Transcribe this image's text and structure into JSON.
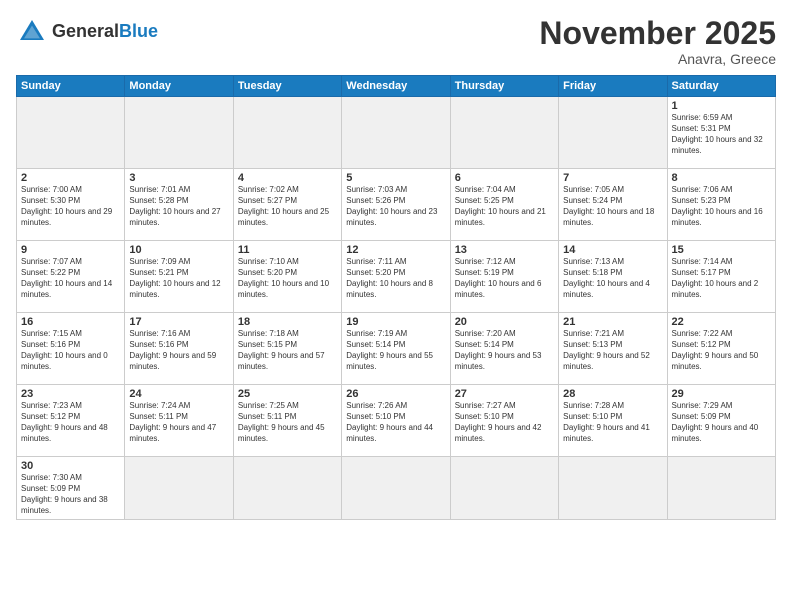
{
  "header": {
    "logo_general": "General",
    "logo_blue": "Blue",
    "month_title": "November 2025",
    "location": "Anavra, Greece"
  },
  "weekdays": [
    "Sunday",
    "Monday",
    "Tuesday",
    "Wednesday",
    "Thursday",
    "Friday",
    "Saturday"
  ],
  "weeks": [
    [
      {
        "day": "",
        "empty": true
      },
      {
        "day": "",
        "empty": true
      },
      {
        "day": "",
        "empty": true
      },
      {
        "day": "",
        "empty": true
      },
      {
        "day": "",
        "empty": true
      },
      {
        "day": "",
        "empty": true
      },
      {
        "day": "1",
        "sunrise": "6:59 AM",
        "sunset": "5:31 PM",
        "daylight": "10 hours and 32 minutes."
      }
    ],
    [
      {
        "day": "2",
        "sunrise": "7:00 AM",
        "sunset": "5:30 PM",
        "daylight": "10 hours and 29 minutes."
      },
      {
        "day": "3",
        "sunrise": "7:01 AM",
        "sunset": "5:28 PM",
        "daylight": "10 hours and 27 minutes."
      },
      {
        "day": "4",
        "sunrise": "7:02 AM",
        "sunset": "5:27 PM",
        "daylight": "10 hours and 25 minutes."
      },
      {
        "day": "5",
        "sunrise": "7:03 AM",
        "sunset": "5:26 PM",
        "daylight": "10 hours and 23 minutes."
      },
      {
        "day": "6",
        "sunrise": "7:04 AM",
        "sunset": "5:25 PM",
        "daylight": "10 hours and 21 minutes."
      },
      {
        "day": "7",
        "sunrise": "7:05 AM",
        "sunset": "5:24 PM",
        "daylight": "10 hours and 18 minutes."
      },
      {
        "day": "8",
        "sunrise": "7:06 AM",
        "sunset": "5:23 PM",
        "daylight": "10 hours and 16 minutes."
      }
    ],
    [
      {
        "day": "9",
        "sunrise": "7:07 AM",
        "sunset": "5:22 PM",
        "daylight": "10 hours and 14 minutes."
      },
      {
        "day": "10",
        "sunrise": "7:09 AM",
        "sunset": "5:21 PM",
        "daylight": "10 hours and 12 minutes."
      },
      {
        "day": "11",
        "sunrise": "7:10 AM",
        "sunset": "5:20 PM",
        "daylight": "10 hours and 10 minutes."
      },
      {
        "day": "12",
        "sunrise": "7:11 AM",
        "sunset": "5:20 PM",
        "daylight": "10 hours and 8 minutes."
      },
      {
        "day": "13",
        "sunrise": "7:12 AM",
        "sunset": "5:19 PM",
        "daylight": "10 hours and 6 minutes."
      },
      {
        "day": "14",
        "sunrise": "7:13 AM",
        "sunset": "5:18 PM",
        "daylight": "10 hours and 4 minutes."
      },
      {
        "day": "15",
        "sunrise": "7:14 AM",
        "sunset": "5:17 PM",
        "daylight": "10 hours and 2 minutes."
      }
    ],
    [
      {
        "day": "16",
        "sunrise": "7:15 AM",
        "sunset": "5:16 PM",
        "daylight": "10 hours and 0 minutes."
      },
      {
        "day": "17",
        "sunrise": "7:16 AM",
        "sunset": "5:16 PM",
        "daylight": "9 hours and 59 minutes."
      },
      {
        "day": "18",
        "sunrise": "7:18 AM",
        "sunset": "5:15 PM",
        "daylight": "9 hours and 57 minutes."
      },
      {
        "day": "19",
        "sunrise": "7:19 AM",
        "sunset": "5:14 PM",
        "daylight": "9 hours and 55 minutes."
      },
      {
        "day": "20",
        "sunrise": "7:20 AM",
        "sunset": "5:14 PM",
        "daylight": "9 hours and 53 minutes."
      },
      {
        "day": "21",
        "sunrise": "7:21 AM",
        "sunset": "5:13 PM",
        "daylight": "9 hours and 52 minutes."
      },
      {
        "day": "22",
        "sunrise": "7:22 AM",
        "sunset": "5:12 PM",
        "daylight": "9 hours and 50 minutes."
      }
    ],
    [
      {
        "day": "23",
        "sunrise": "7:23 AM",
        "sunset": "5:12 PM",
        "daylight": "9 hours and 48 minutes."
      },
      {
        "day": "24",
        "sunrise": "7:24 AM",
        "sunset": "5:11 PM",
        "daylight": "9 hours and 47 minutes."
      },
      {
        "day": "25",
        "sunrise": "7:25 AM",
        "sunset": "5:11 PM",
        "daylight": "9 hours and 45 minutes."
      },
      {
        "day": "26",
        "sunrise": "7:26 AM",
        "sunset": "5:10 PM",
        "daylight": "9 hours and 44 minutes."
      },
      {
        "day": "27",
        "sunrise": "7:27 AM",
        "sunset": "5:10 PM",
        "daylight": "9 hours and 42 minutes."
      },
      {
        "day": "28",
        "sunrise": "7:28 AM",
        "sunset": "5:10 PM",
        "daylight": "9 hours and 41 minutes."
      },
      {
        "day": "29",
        "sunrise": "7:29 AM",
        "sunset": "5:09 PM",
        "daylight": "9 hours and 40 minutes."
      }
    ],
    [
      {
        "day": "30",
        "sunrise": "7:30 AM",
        "sunset": "5:09 PM",
        "daylight": "9 hours and 38 minutes."
      },
      {
        "day": "",
        "empty": true
      },
      {
        "day": "",
        "empty": true
      },
      {
        "day": "",
        "empty": true
      },
      {
        "day": "",
        "empty": true
      },
      {
        "day": "",
        "empty": true
      },
      {
        "day": "",
        "empty": true
      }
    ]
  ],
  "labels": {
    "sunrise": "Sunrise:",
    "sunset": "Sunset:",
    "daylight": "Daylight:"
  }
}
